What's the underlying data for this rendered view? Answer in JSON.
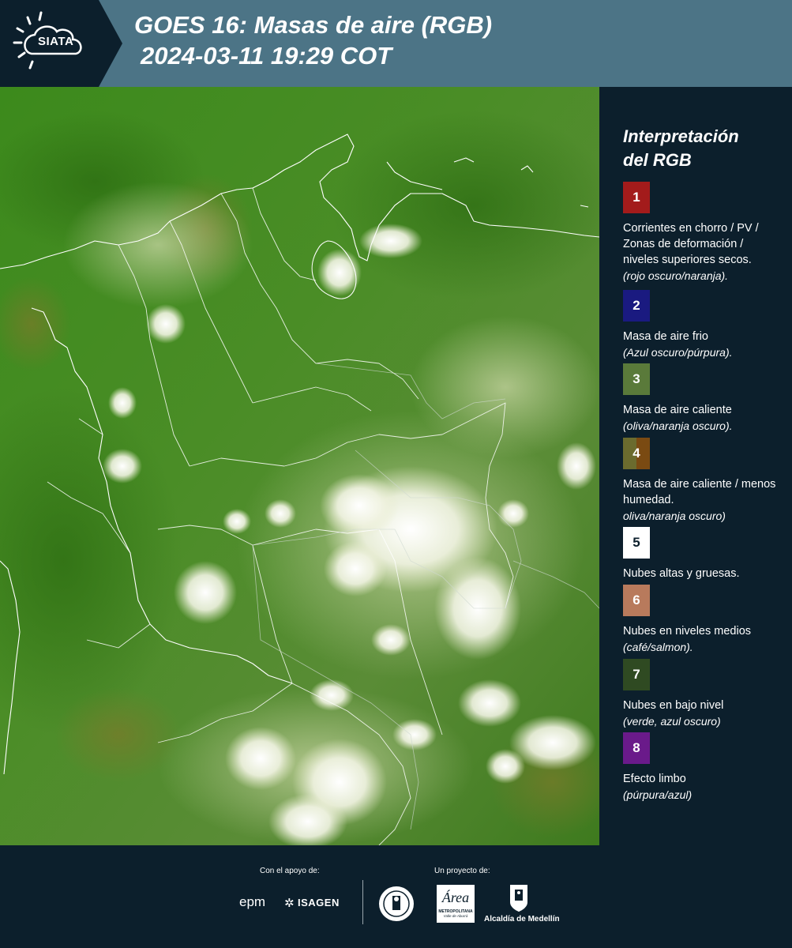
{
  "header": {
    "logo_text": "SIATA",
    "title_line1": "GOES 16: Masas de aire (RGB)",
    "title_line2": "2024-03-11 19:29 COT"
  },
  "legend": {
    "title_line1": "Interpretación",
    "title_line2": "del RGB",
    "items": [
      {
        "number": "1",
        "color": "#a31b1b",
        "text": "Corrientes en chorro / PV / Zonas de deformación / niveles superiores secos.",
        "sub": "(rojo oscuro/naranja)."
      },
      {
        "number": "2",
        "color": "#1a1a80",
        "text": "Masa de aire frio",
        "sub": "(Azul oscuro/púrpura)."
      },
      {
        "number": "3",
        "color": "#5a7a3a",
        "text": "Masa de aire caliente",
        "sub": "(oliva/naranja oscuro)."
      },
      {
        "number": "4",
        "color_left": "#6b6b2e",
        "color_right": "#7a4a12",
        "text": "Masa de aire caliente / menos humedad.",
        "sub": "oliva/naranja oscuro)"
      },
      {
        "number": "5",
        "color": "#ffffff",
        "text": "Nubes altas y gruesas.",
        "sub": ""
      },
      {
        "number": "6",
        "color": "#b87a5c",
        "text": "Nubes en niveles medios",
        "sub": "(café/salmon)."
      },
      {
        "number": "7",
        "color": "#2f4a22",
        "text": "Nubes en bajo nivel",
        "sub": "(verde, azul oscuro)"
      },
      {
        "number": "8",
        "color": "#6a1a8a",
        "text": "Efecto limbo",
        "sub": "(púrpura/azul)"
      }
    ]
  },
  "footer": {
    "support_label": "Con el apoyo de:",
    "project_label": "Un proyecto de:",
    "sponsor_epm": "epm",
    "sponsor_isagen": "ISAGEN",
    "area_metropolitana": "Área",
    "area_metropolitana_sub": "METROPOLITANA",
    "area_metropolitana_sub2": "Valle de Aburrá",
    "alcaldia": "Alcaldía de Medellín"
  },
  "colors": {
    "header_bg": "#4c7486",
    "dark_bg": "#0c1f2c",
    "map_base": "#4a8a22"
  }
}
